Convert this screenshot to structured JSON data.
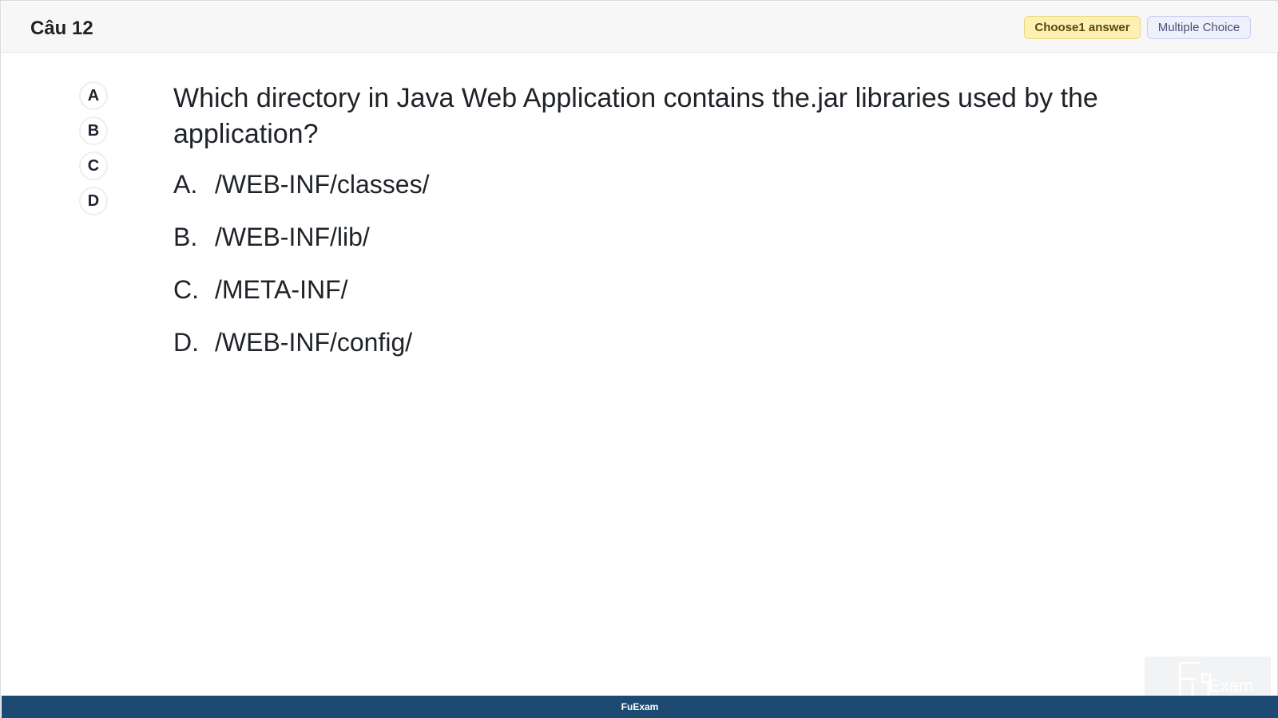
{
  "header": {
    "question_number": "Câu 12",
    "badge_choose": "Choose1 answer",
    "badge_type": "Multiple Choice"
  },
  "picker": [
    "A",
    "B",
    "C",
    "D"
  ],
  "question": {
    "text": "Which directory in Java Web Application contains the.jar libraries used by the application?"
  },
  "options": [
    {
      "letter": "A.",
      "text": "/WEB-INF/classes/"
    },
    {
      "letter": "B.",
      "text": "/WEB-INF/lib/"
    },
    {
      "letter": "C.",
      "text": "/META-INF/"
    },
    {
      "letter": "D.",
      "text": "/WEB-INF/config/"
    }
  ],
  "footer": {
    "brand": "FuExam"
  },
  "watermark": {
    "logo": "fuexam-logo",
    "text": "Exam"
  },
  "colors": {
    "footer_bg": "#1d4a72",
    "badge_choose_bg": "#fdf0b3",
    "badge_type_bg": "#eef0fb"
  }
}
